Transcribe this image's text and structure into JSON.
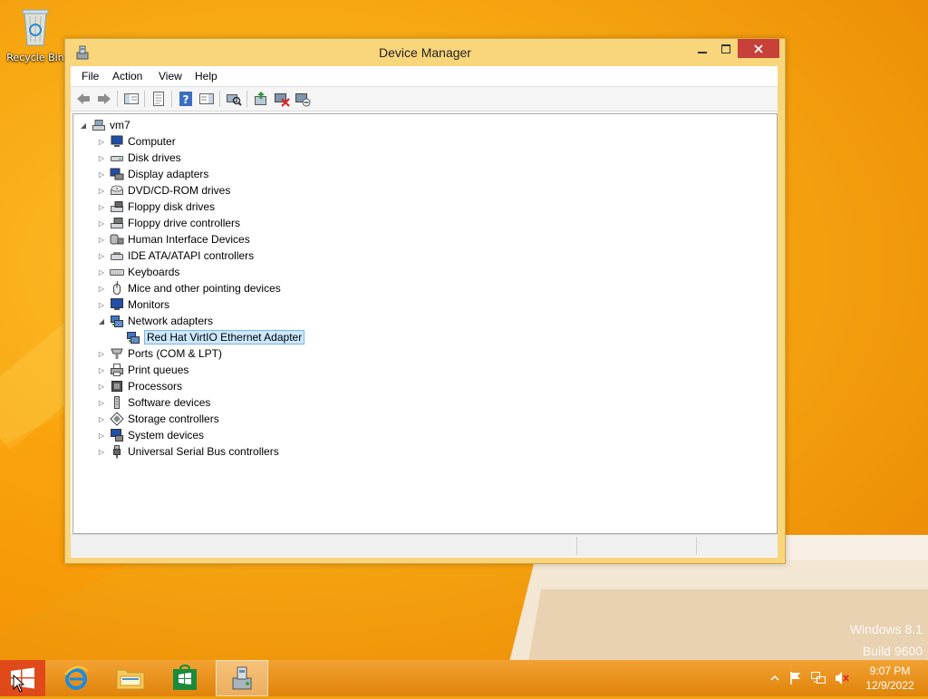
{
  "desktop": {
    "recycle_bin_label": "Recycle Bin",
    "watermark_line1": "Windows 8.1",
    "watermark_line2": "Build 9600"
  },
  "window": {
    "title": "Device Manager",
    "controls": {
      "minimize": "minimize-icon",
      "maximize": "maximize-icon",
      "close": "close-icon"
    }
  },
  "menu": {
    "file": "File",
    "action": "Action",
    "view": "View",
    "help": "Help"
  },
  "toolbar": {
    "items": [
      "back-icon",
      "forward-icon",
      "show-hide-console-tree-icon",
      "properties-icon",
      "help-icon",
      "action-pane-icon",
      "scan-hardware-icon",
      "update-driver-icon",
      "uninstall-device-icon",
      "disable-device-icon"
    ]
  },
  "tree": {
    "root": "vm7",
    "categories": [
      {
        "label": "Computer",
        "icon": "computer-icon"
      },
      {
        "label": "Disk drives",
        "icon": "disk-drive-icon"
      },
      {
        "label": "Display adapters",
        "icon": "display-adapter-icon"
      },
      {
        "label": "DVD/CD-ROM drives",
        "icon": "dvd-drive-icon"
      },
      {
        "label": "Floppy disk drives",
        "icon": "floppy-disk-icon"
      },
      {
        "label": "Floppy drive controllers",
        "icon": "floppy-controller-icon"
      },
      {
        "label": "Human Interface Devices",
        "icon": "hid-icon"
      },
      {
        "label": "IDE ATA/ATAPI controllers",
        "icon": "ide-controller-icon"
      },
      {
        "label": "Keyboards",
        "icon": "keyboard-icon"
      },
      {
        "label": "Mice and other pointing devices",
        "icon": "mouse-icon"
      },
      {
        "label": "Monitors",
        "icon": "monitor-icon"
      },
      {
        "label": "Network adapters",
        "icon": "network-adapter-icon",
        "expanded": true
      },
      {
        "label": "Ports (COM & LPT)",
        "icon": "port-icon"
      },
      {
        "label": "Print queues",
        "icon": "printer-icon"
      },
      {
        "label": "Processors",
        "icon": "processor-icon"
      },
      {
        "label": "Software devices",
        "icon": "software-device-icon"
      },
      {
        "label": "Storage controllers",
        "icon": "storage-controller-icon"
      },
      {
        "label": "System devices",
        "icon": "system-device-icon"
      },
      {
        "label": "Universal Serial Bus controllers",
        "icon": "usb-icon"
      }
    ],
    "network_child": "Red Hat VirtIO Ethernet Adapter"
  },
  "taskbar": {
    "apps": [
      "internet-explorer-icon",
      "file-explorer-icon",
      "store-icon",
      "device-manager-icon"
    ],
    "tray_icons": [
      "show-hidden-icons-icon",
      "action-center-flag-icon",
      "network-icon",
      "volume-muted-icon"
    ],
    "time": "9:07 PM",
    "date": "12/9/2022"
  },
  "colors": {
    "desktop": "#f7a812",
    "window_frame": "#f9d57c",
    "close_button": "#c7403a",
    "selection": "#cce8ff",
    "taskbar": "#e8890c"
  }
}
